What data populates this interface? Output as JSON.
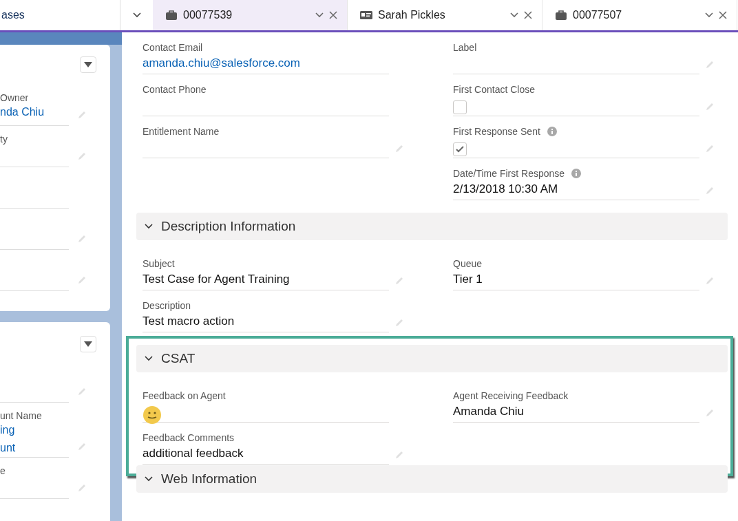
{
  "app_nav": {
    "label": "ases"
  },
  "tabs": [
    {
      "label": "00077539",
      "kind": "case",
      "selected": true
    },
    {
      "label": "Sarah Pickles",
      "kind": "contact",
      "selected": false
    },
    {
      "label": "00077507",
      "kind": "case",
      "selected": false
    }
  ],
  "side_cards": [
    {
      "fields": [
        {
          "label": "Owner",
          "value": "nda Chiu",
          "kind": "link",
          "editable": true
        },
        {
          "label": "ty",
          "editable": true
        },
        {
          "editable": false
        },
        {
          "editable": true
        },
        {
          "editable": true
        }
      ]
    },
    {
      "fields": [
        {
          "editable": true
        },
        {
          "label": "unt Name",
          "value": "ing\nunt",
          "kind": "link",
          "editable": true
        },
        {
          "label": "e",
          "editable": true
        }
      ]
    }
  ],
  "sections": [
    {
      "rows": [
        {
          "left": {
            "label": "Contact Email",
            "value": "amanda.chiu@salesforce.com",
            "kind": "link",
            "editable": false
          },
          "right": {
            "label": "Label",
            "kind": "text",
            "editable": true
          }
        },
        {
          "left": {
            "label": "Contact Phone",
            "kind": "text",
            "editable": false
          },
          "right": {
            "label": "First Contact Close",
            "kind": "checkbox",
            "checked": false,
            "editable": true
          }
        },
        {
          "left": {
            "label": "Entitlement Name",
            "kind": "text",
            "editable": true
          },
          "right": {
            "label": "First Response Sent",
            "kind": "checkbox",
            "checked": true,
            "info": true,
            "editable": true
          }
        },
        {
          "right": {
            "label": "Date/Time First Response",
            "value": "2/13/2018 10:30 AM",
            "kind": "text",
            "info": true,
            "editable": true
          }
        }
      ]
    },
    {
      "title": "Description Information",
      "expanded": true,
      "highlighted": false,
      "rows": [
        {
          "left": {
            "label": "Subject",
            "value": "Test Case for Agent Training",
            "kind": "text",
            "editable": true
          },
          "right": {
            "label": "Queue",
            "value": "Tier 1",
            "kind": "text",
            "editable": true
          }
        },
        {
          "left": {
            "label": "Description",
            "value": "Test macro action",
            "kind": "text",
            "editable": true
          }
        }
      ]
    },
    {
      "title": "CSAT",
      "expanded": true,
      "highlighted": true,
      "rows": [
        {
          "left": {
            "label": "Feedback on Agent",
            "kind": "emoji",
            "editable": false
          },
          "right": {
            "label": "Agent Receiving Feedback",
            "value": "Amanda Chiu",
            "kind": "text",
            "editable": true
          }
        },
        {
          "left": {
            "label": "Feedback Comments",
            "value": "additional feedback",
            "kind": "text",
            "editable": true
          }
        }
      ]
    },
    {
      "title": "Web Information",
      "expanded": true,
      "highlighted": false
    }
  ]
}
